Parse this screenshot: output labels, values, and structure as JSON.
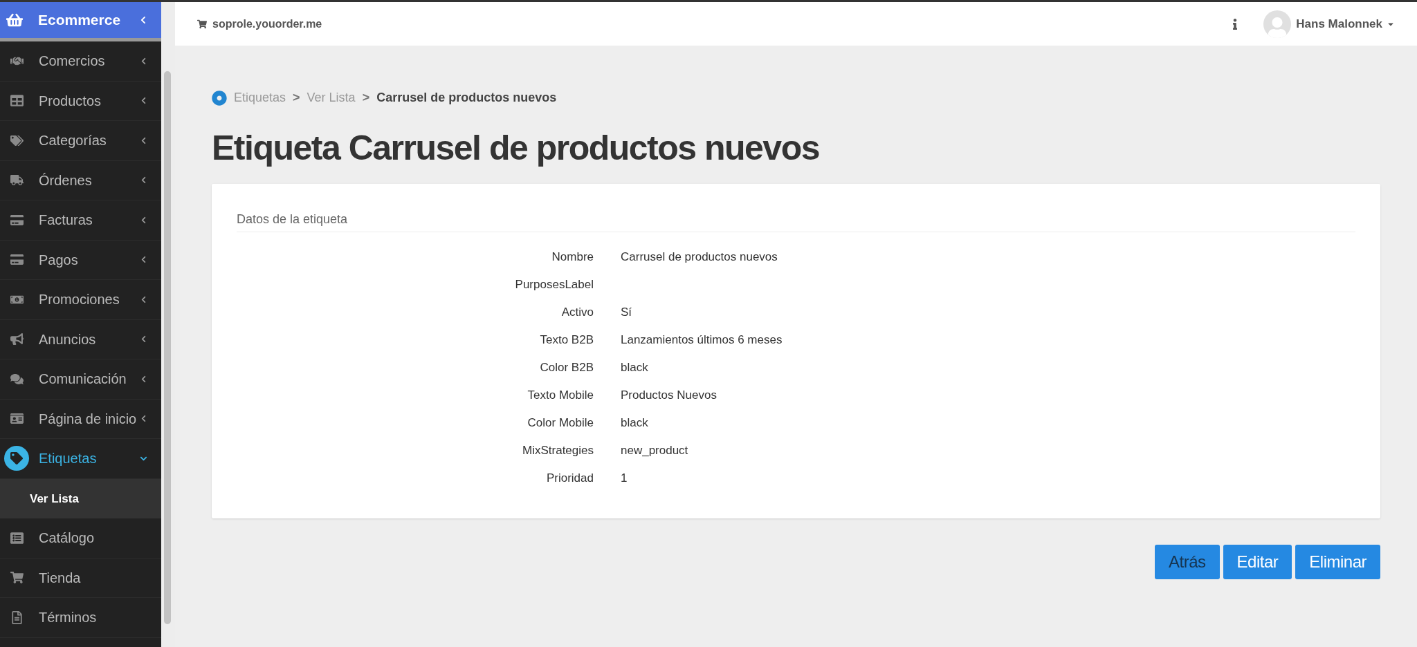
{
  "sidebar": {
    "brand": {
      "label": "Ecommerce",
      "expanded": false
    },
    "items": [
      {
        "label": "Comercios",
        "kind": "group",
        "expanded": false,
        "selected": false
      },
      {
        "label": "Productos",
        "kind": "group",
        "expanded": false,
        "selected": false
      },
      {
        "label": "Categorías",
        "kind": "group",
        "expanded": false,
        "selected": false
      },
      {
        "label": "Órdenes",
        "kind": "group",
        "expanded": false,
        "selected": false
      },
      {
        "label": "Facturas",
        "kind": "group",
        "expanded": false,
        "selected": false
      },
      {
        "label": "Pagos",
        "kind": "group",
        "expanded": false,
        "selected": false
      },
      {
        "label": "Promociones",
        "kind": "group",
        "expanded": false,
        "selected": false
      },
      {
        "label": "Anuncios",
        "kind": "group",
        "expanded": false,
        "selected": false
      },
      {
        "label": "Comunicación",
        "kind": "group",
        "expanded": false,
        "selected": false
      },
      {
        "label": "Página de inicio",
        "kind": "group",
        "expanded": false,
        "selected": false
      },
      {
        "label": "Etiquetas",
        "kind": "group",
        "expanded": true,
        "selected": true,
        "children": [
          {
            "label": "Ver Lista",
            "selected": true
          }
        ]
      },
      {
        "label": "Catálogo",
        "kind": "link",
        "selected": false
      },
      {
        "label": "Tienda",
        "kind": "link",
        "selected": false
      },
      {
        "label": "Términos",
        "kind": "link",
        "selected": false
      }
    ]
  },
  "header": {
    "site": "soprole.youorder.me",
    "user": "Hans Malonnek"
  },
  "breadcrumbs": [
    "Etiquetas",
    ">",
    "Ver Lista",
    ">",
    "Carrusel de productos nuevos"
  ],
  "title": "Etiqueta Carrusel de productos nuevos",
  "card": {
    "title": "Datos de la etiqueta",
    "fields": [
      {
        "label": "Nombre",
        "value": "Carrusel de productos nuevos"
      },
      {
        "label": "PurposesLabel"
      },
      {
        "label": "Activo",
        "value": "Sí"
      },
      {
        "label": "Texto B2B",
        "value": "Lanzamientos últimos 6 meses"
      },
      {
        "label": "Color B2B",
        "value": "black"
      },
      {
        "label": "Texto Mobile",
        "value": "Productos Nuevos"
      },
      {
        "label": "Color Mobile",
        "value": "black"
      },
      {
        "label": "MixStrategies",
        "value": "new_product"
      },
      {
        "label": "Prioridad",
        "value": "1"
      }
    ]
  },
  "buttons": [
    {
      "label": "Atrás",
      "kind": "back"
    },
    {
      "label": "Editar",
      "kind": "primary"
    },
    {
      "label": "Eliminar",
      "kind": "primary"
    }
  ]
}
